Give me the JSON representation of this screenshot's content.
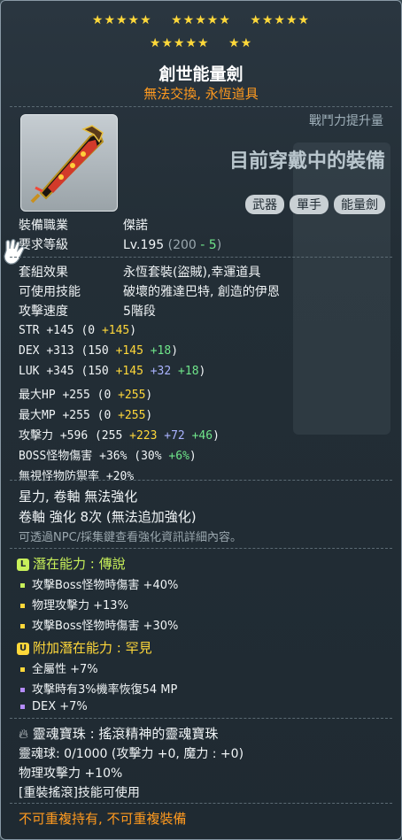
{
  "stars": {
    "row1": [
      "★★★★★",
      "★★★★★",
      "★★★★★"
    ],
    "row2": [
      "★★★★★",
      "★★"
    ]
  },
  "item": {
    "name": "創世能量劍",
    "subtitle": "無法交換, 永恆道具",
    "power_label": "戰鬥力提升量",
    "equipped_text": "目前穿戴中的裝備",
    "tags": [
      "武器",
      "單手",
      "能量劍"
    ]
  },
  "req": {
    "job_label": "裝備職業",
    "job_value": "傑諾",
    "level_label": "要求等級",
    "level_prefix": "Lv.195",
    "level_open": "(200",
    "level_minus": "- 5",
    "level_close": ")"
  },
  "info": {
    "set_label": "套組效果",
    "set_value": "永恆套裝(盜賊),幸運道具",
    "skill_label": "可使用技能",
    "skill_value": "破壞的雅達巴特, 創造的伊恩",
    "speed_label": "攻擊速度",
    "speed_value": "5階段"
  },
  "stats": [
    {
      "name": "STR",
      "total": "+145",
      "base": "(0",
      "parts": [
        [
          "+145",
          "y"
        ]
      ],
      "close": ")"
    },
    {
      "name": "DEX",
      "total": "+313",
      "base": "(150",
      "parts": [
        [
          "+145",
          "y"
        ],
        [
          "+18",
          "g"
        ]
      ],
      "close": ")"
    },
    {
      "name": "LUK",
      "total": "+345",
      "base": "(150",
      "parts": [
        [
          "+145",
          "y"
        ],
        [
          "+32",
          "p"
        ],
        [
          "+18",
          "g"
        ]
      ],
      "close": ")"
    },
    {
      "name": "最大HP",
      "total": "+255",
      "base": "(0",
      "parts": [
        [
          "+255",
          "y"
        ]
      ],
      "close": ")"
    },
    {
      "name": "最大MP",
      "total": "+255",
      "base": "(0",
      "parts": [
        [
          "+255",
          "y"
        ]
      ],
      "close": ")"
    },
    {
      "name": "攻擊力",
      "total": "+596",
      "base": "(255",
      "parts": [
        [
          "+223",
          "y"
        ],
        [
          "+72",
          "p"
        ],
        [
          "+46",
          "g"
        ]
      ],
      "close": ")"
    },
    {
      "name": "BOSS怪物傷害",
      "total": "+36%",
      "base": "(30%",
      "parts": [
        [
          "+6%",
          "g"
        ]
      ],
      "close": ")"
    },
    {
      "name": "無視怪物防禦率",
      "total": "+20%",
      "base": "",
      "parts": [],
      "close": ""
    }
  ],
  "enhance": {
    "line1": "星力, 卷軸 無法強化",
    "line2": "卷軸 強化 8次 (無法追加強化)",
    "line3": "可透過NPC/採集鍵查看強化資訊詳細內容。"
  },
  "potential": {
    "badge": "L",
    "title": "潛在能力 : 傳說",
    "color": "#c8f05a",
    "lines": [
      "攻擊Boss怪物時傷害 +40%",
      "物理攻擊力 +13%",
      "攻擊Boss怪物時傷害 +30%"
    ]
  },
  "bonus": {
    "badge": "U",
    "title": "附加潛在能力 : 罕見",
    "color": "#ffd83a",
    "lines": [
      "全屬性 +7%",
      "攻擊時有3%機率恢復54 MP",
      "DEX +7%"
    ]
  },
  "soul": {
    "title": "靈魂寶珠 : 搖滾精神的靈魂寶珠",
    "line1": "靈魂球: 0/1000 (攻擊力 +0, 魔力 : +0)",
    "line2": "物理攻擊力 +10%",
    "line3": "[重裝搖滾]技能可使用"
  },
  "footer": "不可重複持有, 不可重複裝備"
}
